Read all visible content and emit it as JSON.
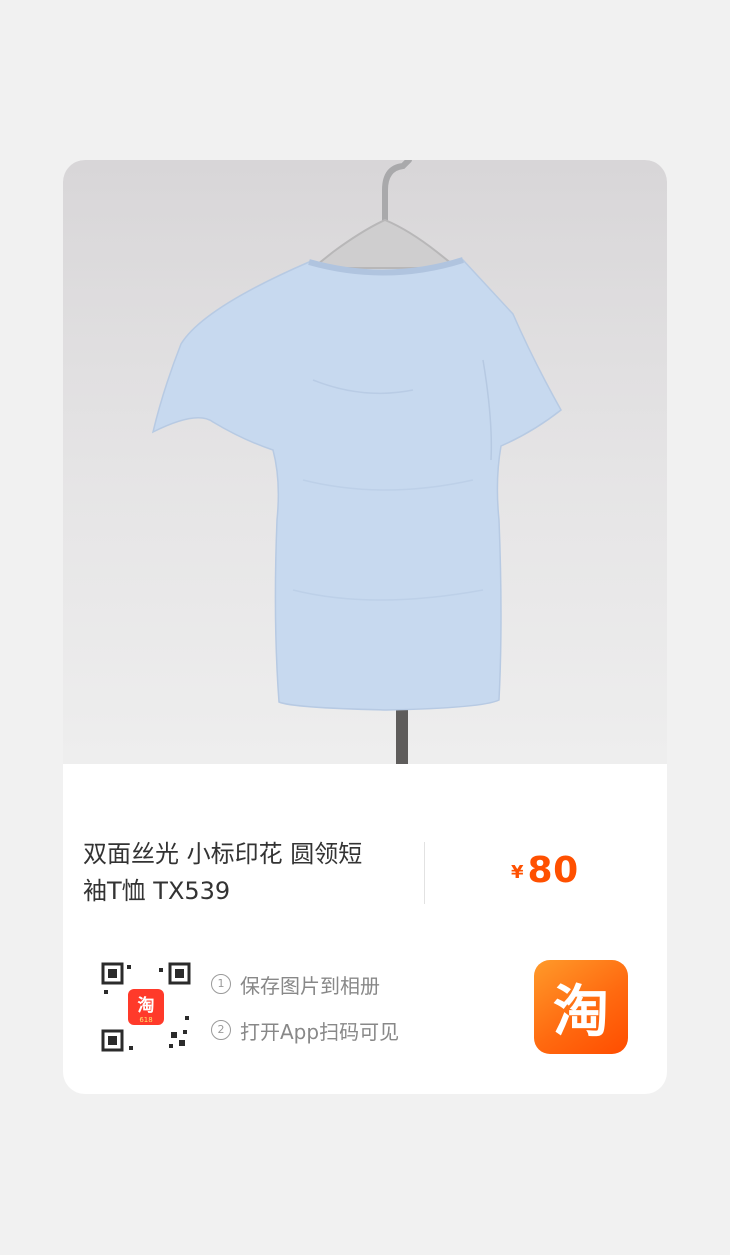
{
  "product": {
    "title_line1": "双面丝光 小标印花 圆领短",
    "title_line2": "袖T恤 TX539"
  },
  "price": {
    "currency": "¥",
    "amount": "80"
  },
  "qr": {
    "badge_char": "淘",
    "badge_text": "618"
  },
  "steps": [
    {
      "num": "1",
      "text": "保存图片到相册"
    },
    {
      "num": "2",
      "text": "打开App扫码可见"
    }
  ],
  "logo": {
    "char": "淘"
  },
  "colors": {
    "accent": "#ff5000",
    "shirt": "#c6d8ee"
  }
}
